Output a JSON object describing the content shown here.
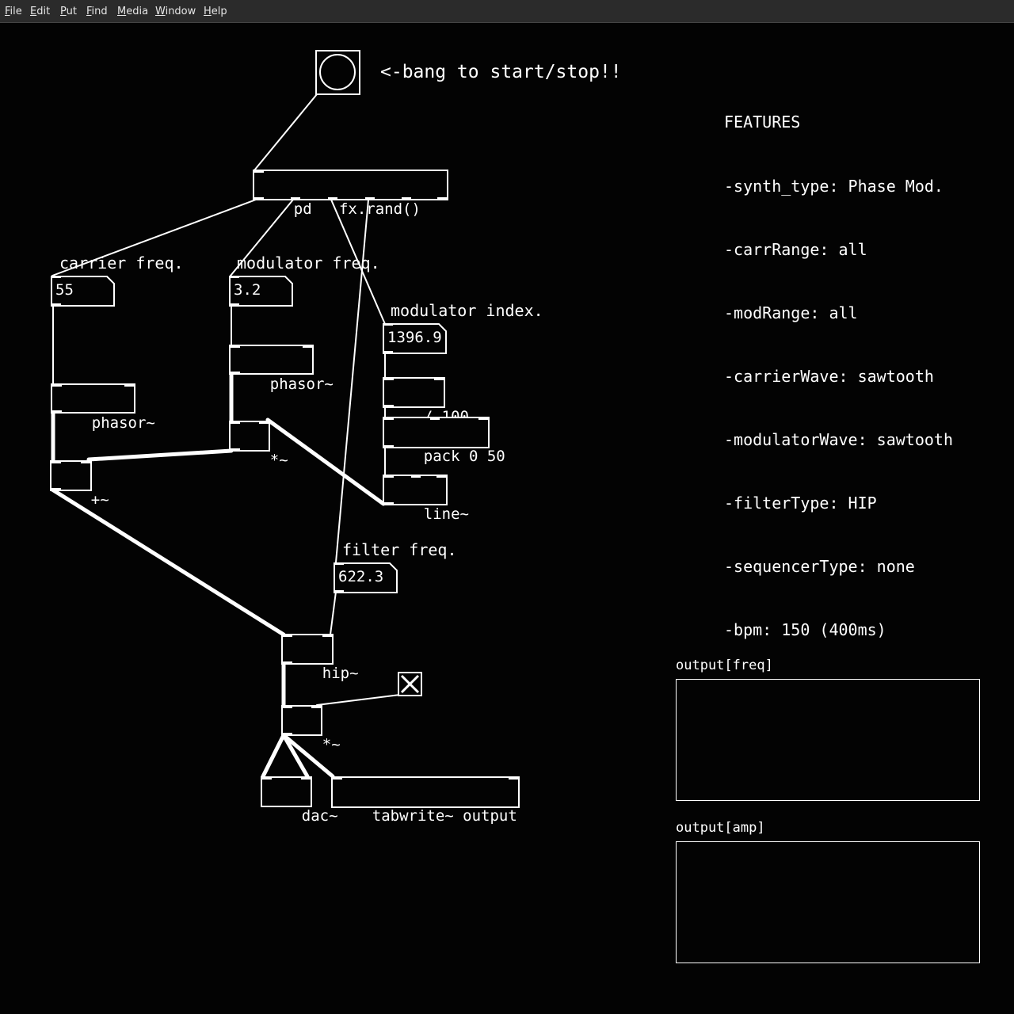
{
  "menu": [
    {
      "key": "F",
      "rest": "ile"
    },
    {
      "key": "E",
      "rest": "dit"
    },
    {
      "key": "P",
      "rest": "ut"
    },
    {
      "key": "F",
      "rest": "ind"
    },
    {
      "key": "M",
      "rest": "edia"
    },
    {
      "key": "W",
      "rest": "indow"
    },
    {
      "key": "H",
      "rest": "elp"
    }
  ],
  "comments": {
    "bang_hint": "<-bang to start/stop!!",
    "carrier_freq": "carrier freq.",
    "modulator_freq": "modulator freq.",
    "modulator_index": "modulator index.",
    "filter_freq": "filter freq."
  },
  "features": [
    "FEATURES",
    "-synth_type: Phase Mod.",
    "-carrRange: all",
    "-modRange: all",
    "-carrierWave: sawtooth",
    "-modulatorWave: sawtooth",
    "-filterType: HIP",
    "-sequencerType: none",
    "-bpm: 150 (400ms)"
  ],
  "objects": {
    "pd_rand": "pd   fx.rand()",
    "phasor_carrier": "phasor~",
    "phasor_mod": "phasor~",
    "mult_mod": "*~",
    "add": "+~",
    "div": "/ 100",
    "pack": "pack 0 50",
    "line": "line~",
    "hip": "hip~",
    "mult_out": "*~",
    "dac": "dac~",
    "tabwrite": "tabwrite~ output"
  },
  "numbers": {
    "carrier": "55",
    "modulator": "3.2",
    "index": "1396.9",
    "filter": "622.3"
  },
  "arrays": {
    "freq_label": "output[freq]",
    "amp_label": "output[amp]"
  },
  "toggle_on": true
}
